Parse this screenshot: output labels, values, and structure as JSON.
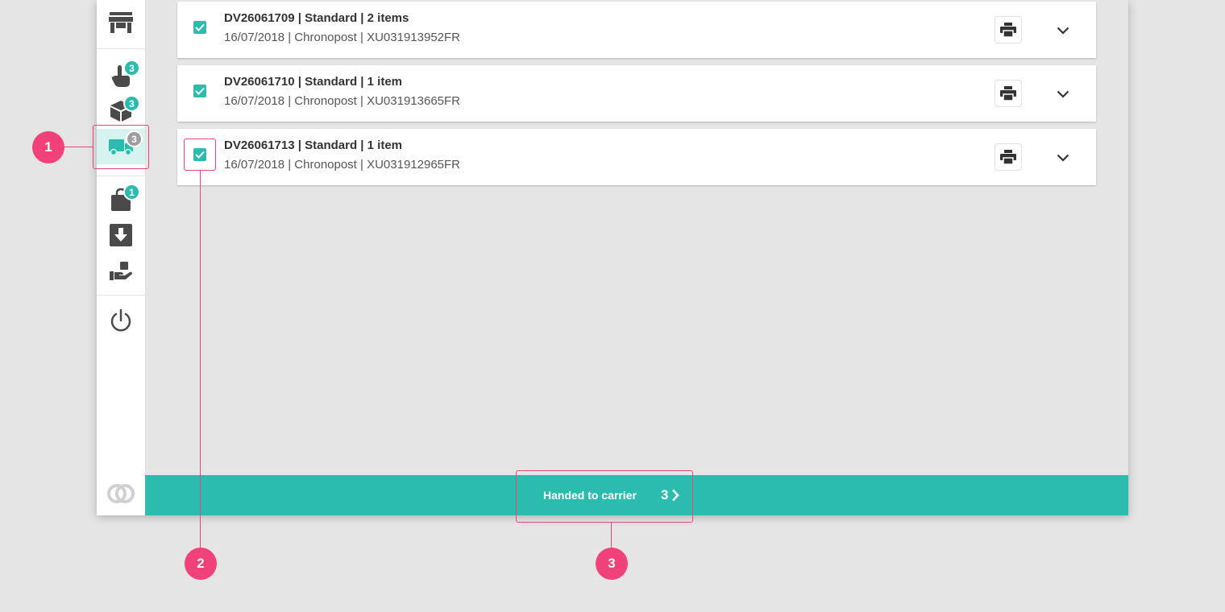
{
  "sidebar": {
    "items": [
      {
        "name": "store",
        "icon": "store-icon"
      },
      {
        "name": "pick",
        "icon": "hand-pointer-icon",
        "badge": "3"
      },
      {
        "name": "pack",
        "icon": "package-icon",
        "badge": "3"
      },
      {
        "name": "ship",
        "icon": "truck-icon",
        "badge": "3",
        "active": true
      },
      {
        "name": "bag",
        "icon": "shopping-bag-icon",
        "badge": "1"
      },
      {
        "name": "download",
        "icon": "download-box-icon"
      },
      {
        "name": "handover",
        "icon": "hand-package-icon"
      },
      {
        "name": "logout",
        "icon": "power-icon"
      }
    ],
    "logo": "brand-logo-icon"
  },
  "orders": [
    {
      "title": "DV26061709 | Standard | 2 items",
      "subtitle": "16/07/2018 | Chronopost | XU031913952FR",
      "checked": true
    },
    {
      "title": "DV26061710 | Standard | 1 item",
      "subtitle": "16/07/2018 | Chronopost | XU031913665FR",
      "checked": true
    },
    {
      "title": "DV26061713 | Standard | 1 item",
      "subtitle": "16/07/2018 | Chronopost | XU031912965FR",
      "checked": true
    }
  ],
  "footer": {
    "action_label": "Handed to carrier",
    "count": "3"
  },
  "callouts": [
    "1",
    "2",
    "3"
  ],
  "colors": {
    "accent": "#2bbcaf",
    "callout": "#f0417a",
    "active_bg": "#d6f3ef",
    "background": "#e5e5e5"
  }
}
